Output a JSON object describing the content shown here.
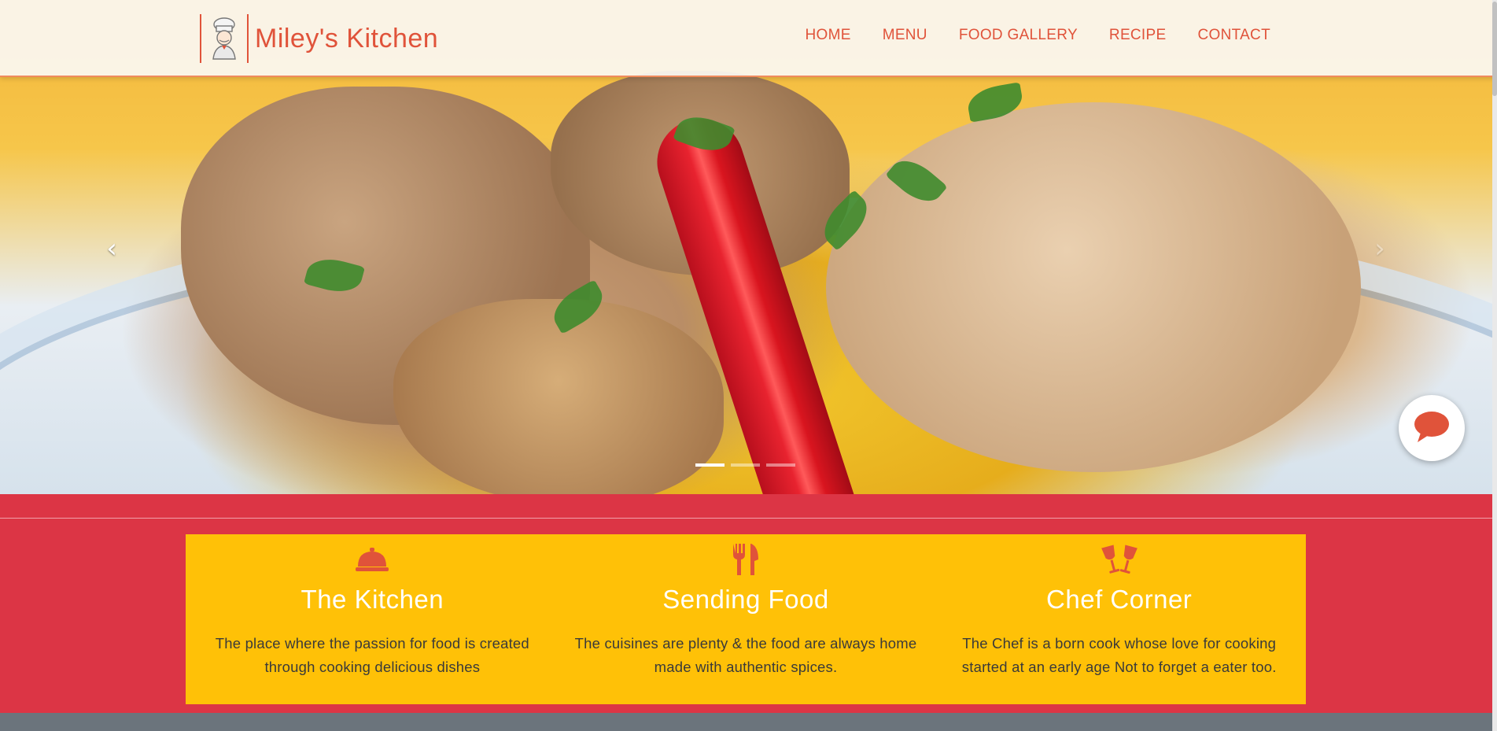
{
  "brand": {
    "name": "Miley's Kitchen",
    "logo_icon": "chef-icon"
  },
  "nav": {
    "items": [
      {
        "label": "HOME"
      },
      {
        "label": "MENU"
      },
      {
        "label": "FOOD GALLERY"
      },
      {
        "label": "RECIPE"
      },
      {
        "label": "CONTACT"
      }
    ]
  },
  "carousel": {
    "prev_icon": "chevron-left-icon",
    "next_icon": "chevron-right-icon",
    "prev_glyph": "‹",
    "next_glyph": "›",
    "slide_count": 3,
    "active_slide": 1
  },
  "features": [
    {
      "icon": "cloche-icon",
      "title": "The Kitchen",
      "text": "The place where the passion for food is created through cooking delicious dishes"
    },
    {
      "icon": "utensils-icon",
      "title": "Sending Food",
      "text": "The cuisines are plenty & the food are always home made with authentic spices."
    },
    {
      "icon": "glasses-cheers-icon",
      "title": "Chef Corner",
      "text": "The Chef is a born cook whose love for cooking started at an early age Not to forget a eater too."
    }
  ],
  "chat": {
    "icon": "chat-bubble-icon"
  },
  "colors": {
    "accent": "#e0533a",
    "band_red": "#dc3545",
    "feature_yellow": "#ffc107",
    "footer_gray": "#6b747c"
  }
}
